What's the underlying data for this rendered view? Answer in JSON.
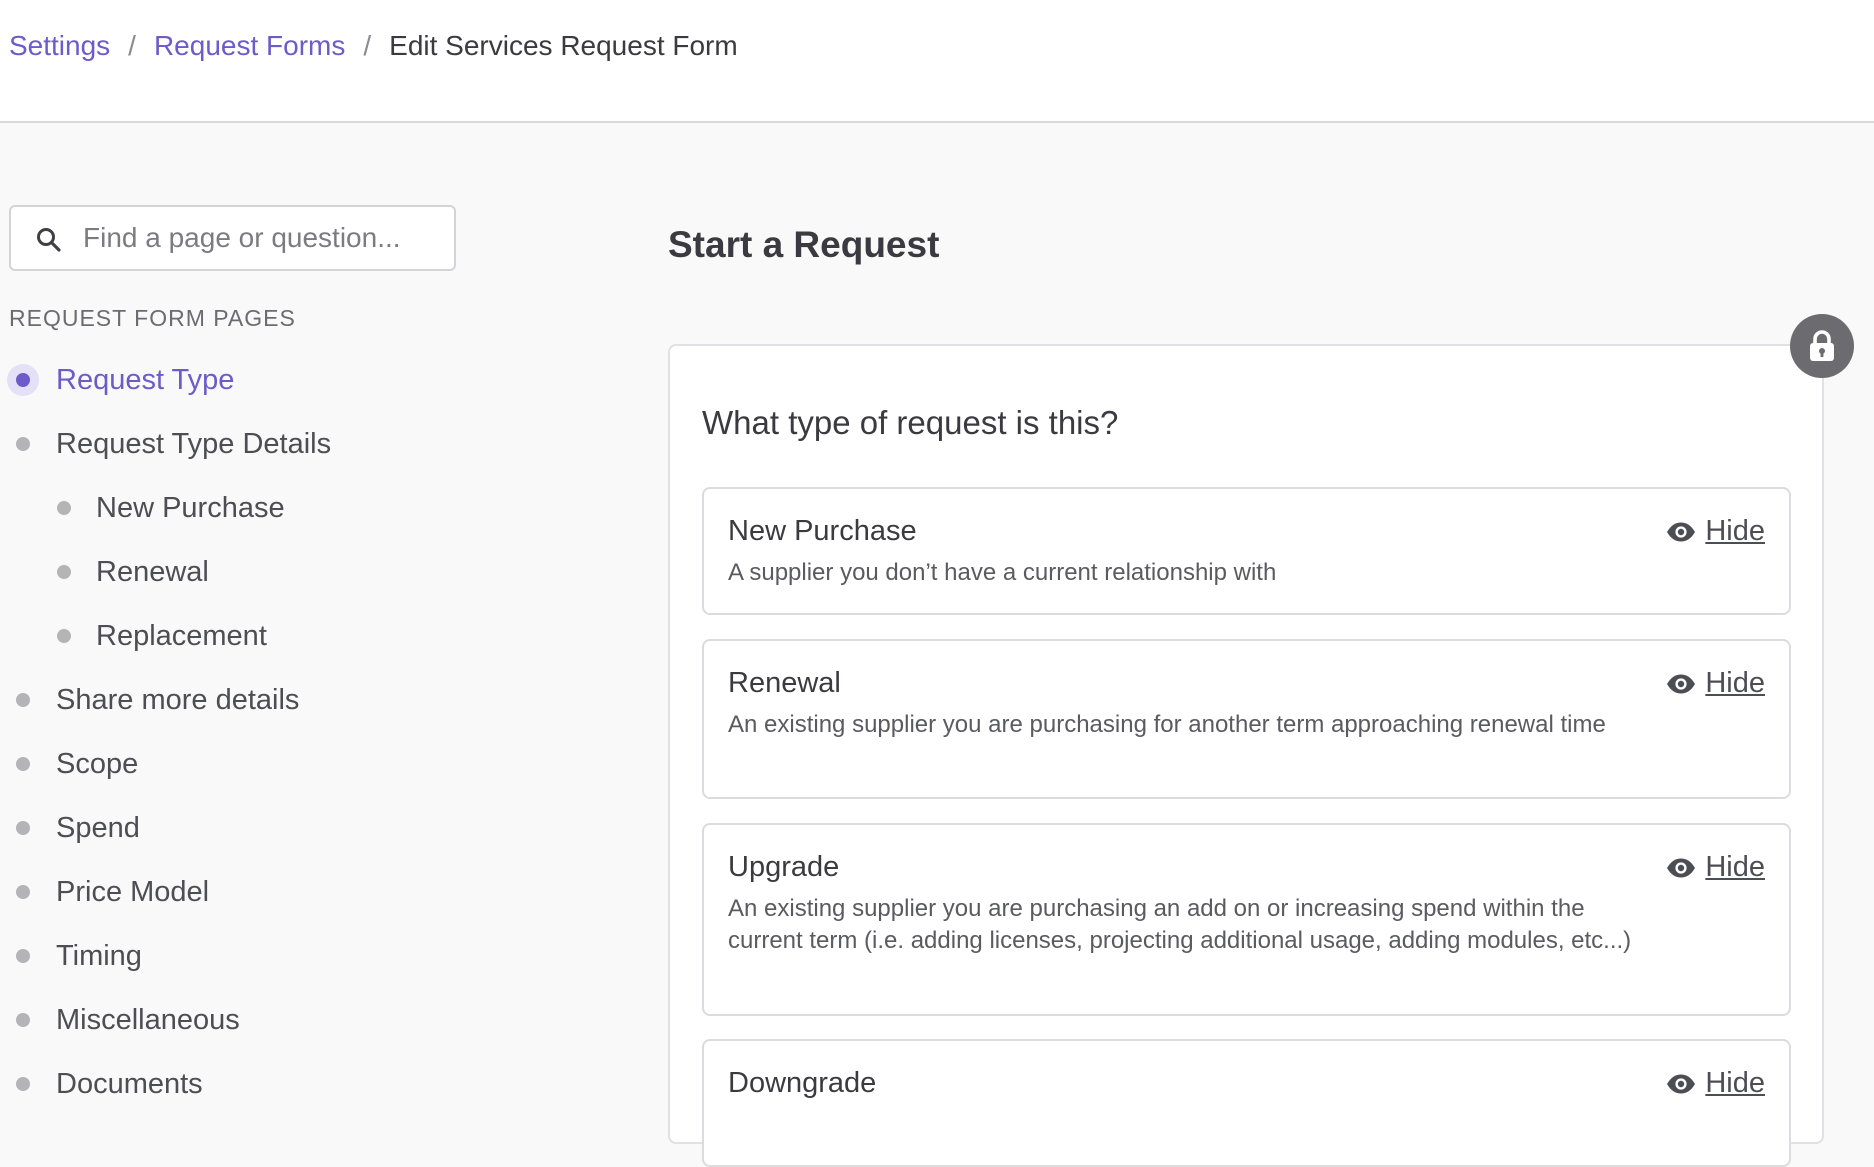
{
  "breadcrumb": {
    "items": [
      {
        "label": "Settings"
      },
      {
        "label": "Request Forms"
      }
    ],
    "separator": "/",
    "current": "Edit Services Request Form"
  },
  "sidebar": {
    "search": {
      "placeholder": "Find a page or question...",
      "value": ""
    },
    "section_title": "REQUEST FORM PAGES",
    "items": [
      {
        "label": "Request Type"
      },
      {
        "label": "Request Type Details"
      },
      {
        "label": "New Purchase"
      },
      {
        "label": "Renewal"
      },
      {
        "label": "Replacement"
      },
      {
        "label": "Share more details"
      },
      {
        "label": "Scope"
      },
      {
        "label": "Spend"
      },
      {
        "label": "Price Model"
      },
      {
        "label": "Timing"
      },
      {
        "label": "Miscellaneous"
      },
      {
        "label": "Documents"
      }
    ]
  },
  "main": {
    "page_heading": "Start a Request",
    "question": "What type of request is this?",
    "options": [
      {
        "title": "New Purchase",
        "description": "A supplier you don’t have a current relationship with",
        "action": "Hide"
      },
      {
        "title": "Renewal",
        "description": "An existing supplier you are purchasing for another term approaching renewal time",
        "action": "Hide"
      },
      {
        "title": "Upgrade",
        "description": "An existing supplier you are purchasing an add on or increasing spend within the current term (i.e. adding licenses, projecting additional usage, adding modules, etc...)",
        "action": "Hide"
      },
      {
        "title": "Downgrade",
        "description": "",
        "action": "Hide"
      }
    ]
  },
  "colors": {
    "accent": "#6c5bc9",
    "accent_light": "#e4e0f7",
    "text": "#3f3f46",
    "muted_dot": "#b4b4b8",
    "lock_bg": "#6b6b70"
  },
  "icons": [
    "search-icon",
    "lock-icon",
    "eye-icon"
  ]
}
